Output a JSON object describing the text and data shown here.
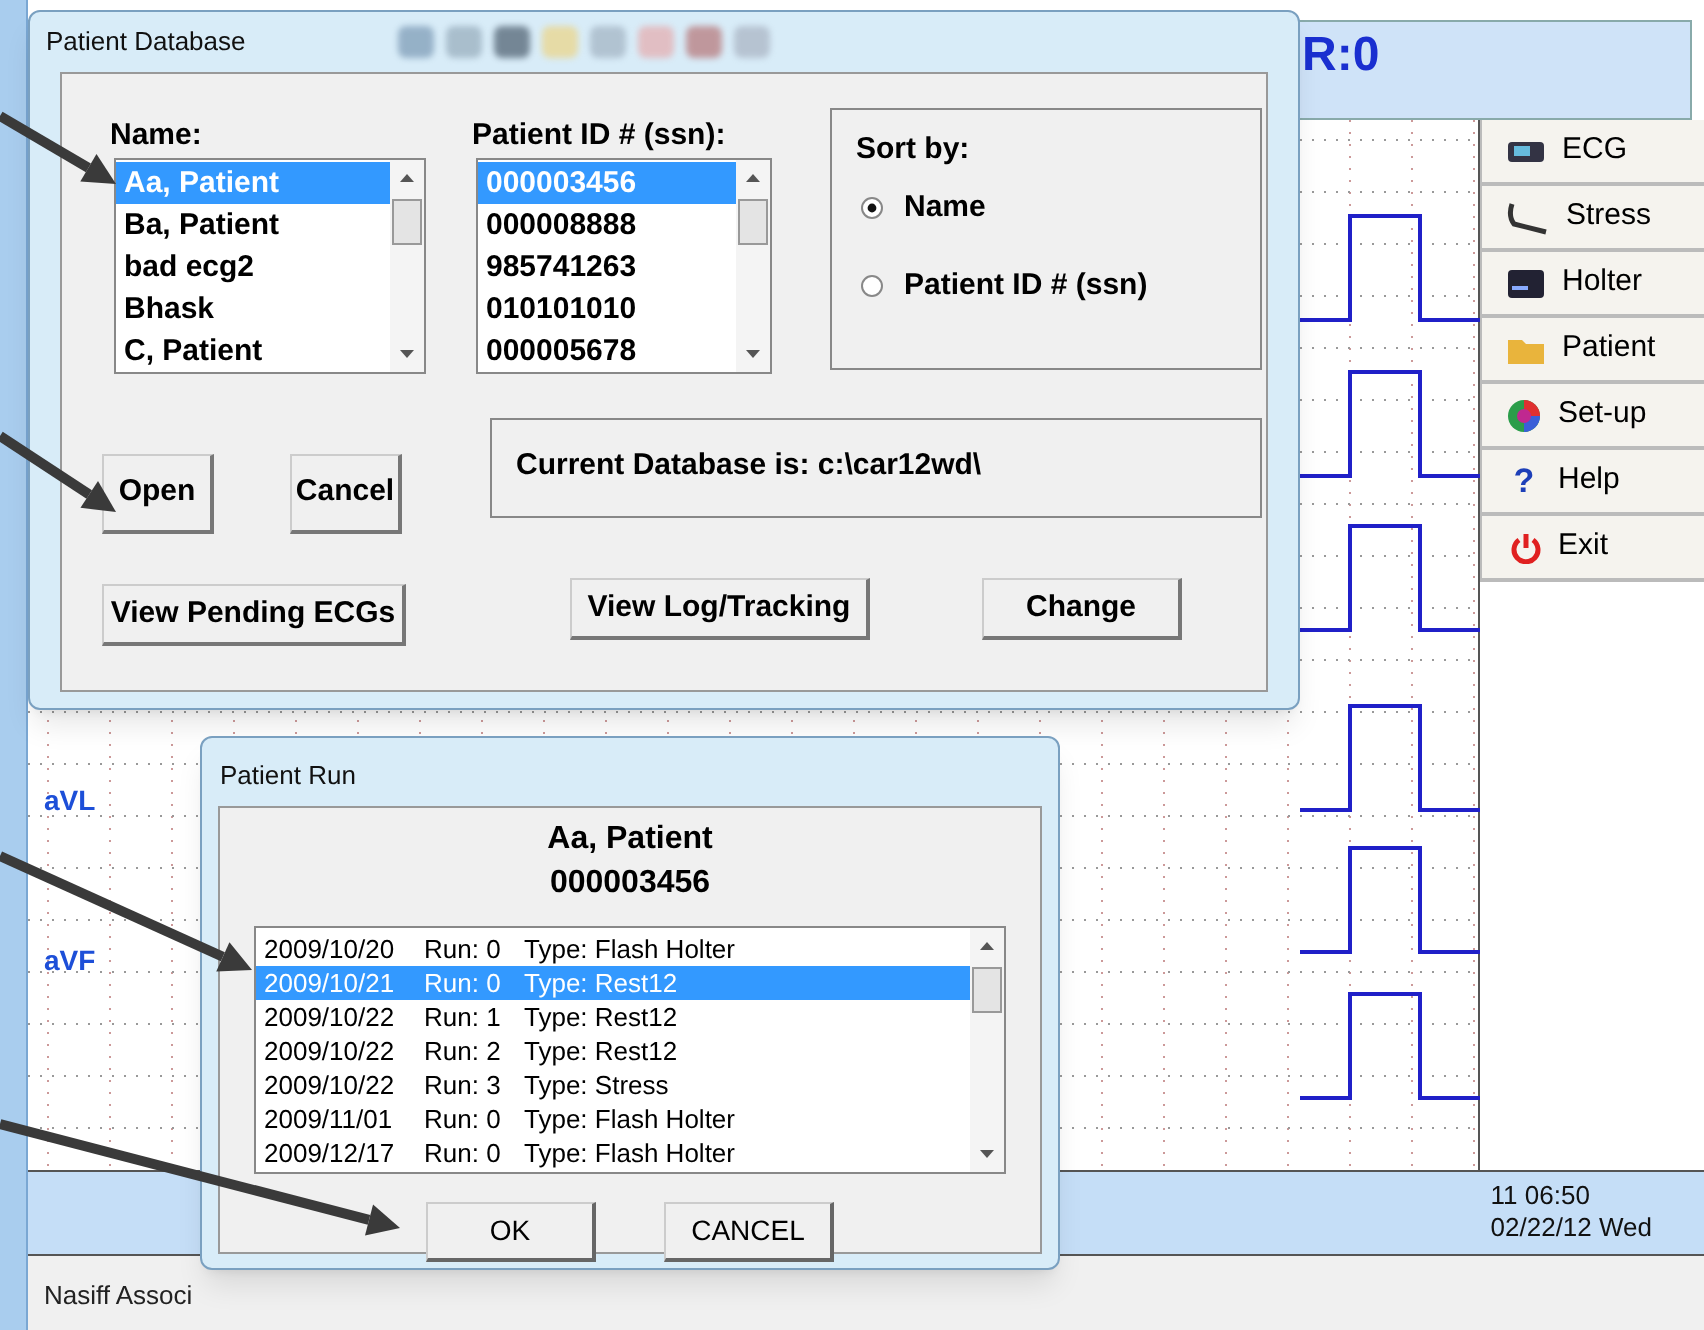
{
  "app": {
    "header_reading": "R:0",
    "leads": [
      "aVL",
      "aVF"
    ],
    "menu": [
      {
        "label": "ECG",
        "kind": "ecg"
      },
      {
        "label": "Stress",
        "kind": "stress"
      },
      {
        "label": "Holter",
        "kind": "holter"
      },
      {
        "label": "Patient",
        "kind": "folder"
      },
      {
        "label": "Set-up",
        "kind": "setup"
      },
      {
        "label": "Help",
        "kind": "help",
        "icon_text": "?"
      },
      {
        "label": "Exit",
        "kind": "exit"
      }
    ],
    "clock": {
      "time": "11 06:50",
      "date": "02/22/12 Wed"
    },
    "status_text": "Nasiff Associ"
  },
  "patient_database": {
    "title": "Patient Database",
    "name_label": "Name:",
    "names": [
      {
        "text": "Aa, Patient",
        "selected": true
      },
      {
        "text": "Ba, Patient",
        "selected": false
      },
      {
        "text": "bad ecg2",
        "selected": false
      },
      {
        "text": "Bhask",
        "selected": false
      },
      {
        "text": "C, Patient",
        "selected": false
      }
    ],
    "id_label": "Patient ID # (ssn):",
    "ids": [
      {
        "text": "000003456",
        "selected": true
      },
      {
        "text": "000008888",
        "selected": false
      },
      {
        "text": "985741263",
        "selected": false
      },
      {
        "text": "010101010",
        "selected": false
      },
      {
        "text": "000005678",
        "selected": false
      }
    ],
    "sort": {
      "label": "Sort by:",
      "options": [
        {
          "label": "Name",
          "selected": true
        },
        {
          "label": "Patient ID # (ssn)",
          "selected": false
        }
      ]
    },
    "current_database": "Current Database is: c:\\car12wd\\",
    "buttons": {
      "open": "Open",
      "cancel": "Cancel",
      "pending": "View Pending ECGs",
      "log": "View Log/Tracking",
      "change": "Change"
    }
  },
  "patient_run": {
    "title": "Patient Run",
    "patient_name": "Aa, Patient",
    "patient_id": "000003456",
    "runs": [
      {
        "date": "2009/10/20",
        "run": "Run: 0",
        "type": "Type: Flash Holter",
        "selected": false
      },
      {
        "date": "2009/10/21",
        "run": "Run: 0",
        "type": "Type: Rest12",
        "selected": true
      },
      {
        "date": "2009/10/22",
        "run": "Run: 1",
        "type": "Type: Rest12",
        "selected": false
      },
      {
        "date": "2009/10/22",
        "run": "Run: 2",
        "type": "Type: Rest12",
        "selected": false
      },
      {
        "date": "2009/10/22",
        "run": "Run: 3",
        "type": "Type: Stress",
        "selected": false
      },
      {
        "date": "2009/11/01",
        "run": "Run: 0",
        "type": "Type: Flash Holter",
        "selected": false
      },
      {
        "date": "2009/12/17",
        "run": "Run: 0",
        "type": "Type: Flash Holter",
        "selected": false
      }
    ],
    "buttons": [
      "OK",
      "CANCEL"
    ]
  }
}
